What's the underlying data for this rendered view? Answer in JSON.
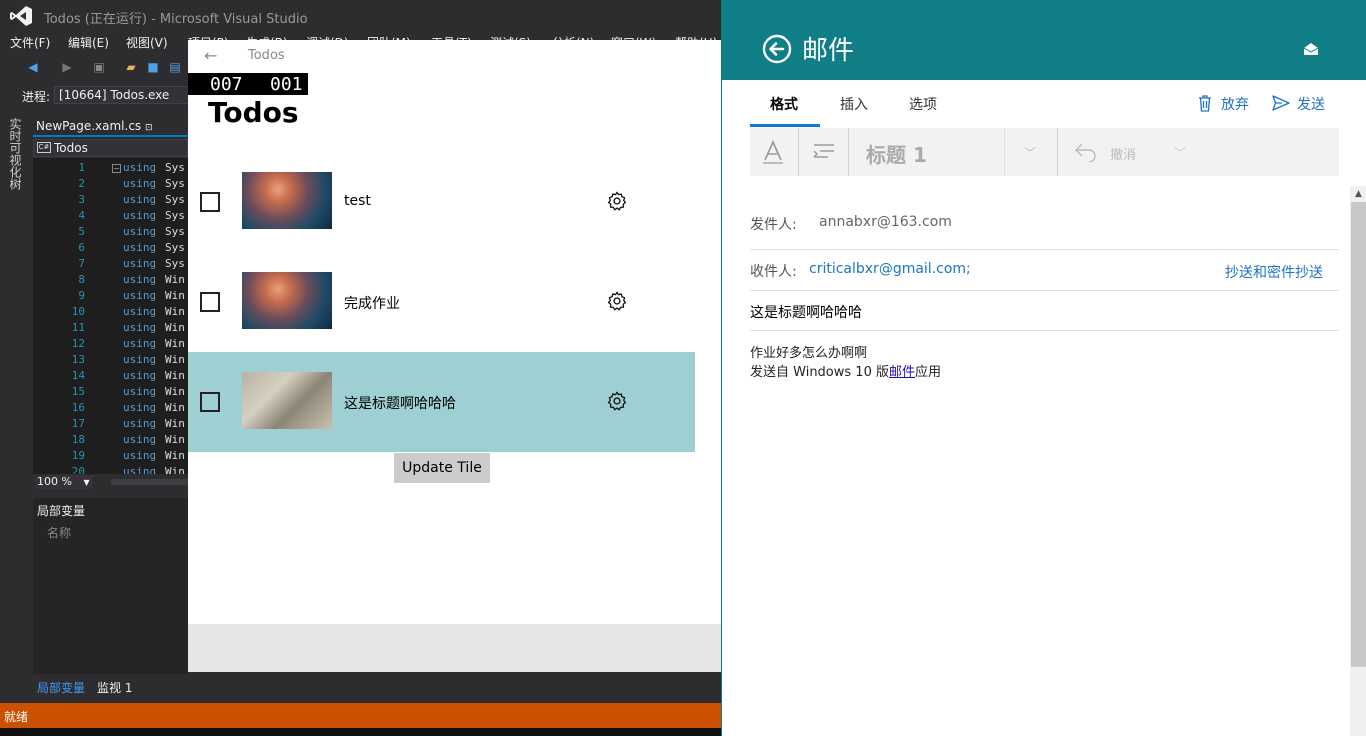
{
  "vs": {
    "title": "Todos (正在运行) - Microsoft Visual Studio",
    "menu": [
      "文件(F)",
      "编辑(E)",
      "视图(V)",
      "项目(P)",
      "生成(B)",
      "调试(D)",
      "团队(M)",
      "工具(T)",
      "测试(S)",
      "分析(N)",
      "窗口(W)",
      "帮助(H)"
    ],
    "process_label": "进程:",
    "process_value": "[10664] Todos.exe",
    "left_tool_label": "实时可视化树",
    "doc_tab": "NewPage.xaml.cs",
    "doc_tab_pin": "⊡",
    "nav_cs_badge": "C#",
    "nav_label": "Todos",
    "code_lines": [
      {
        "n": "1",
        "kw": "using",
        "ns": "Sys"
      },
      {
        "n": "2",
        "kw": "using",
        "ns": "Sys"
      },
      {
        "n": "3",
        "kw": "using",
        "ns": "Sys"
      },
      {
        "n": "4",
        "kw": "using",
        "ns": "Sys"
      },
      {
        "n": "5",
        "kw": "using",
        "ns": "Sys"
      },
      {
        "n": "6",
        "kw": "using",
        "ns": "Sys"
      },
      {
        "n": "7",
        "kw": "using",
        "ns": "Sys"
      },
      {
        "n": "8",
        "kw": "using",
        "ns": "Win"
      },
      {
        "n": "9",
        "kw": "using",
        "ns": "Win"
      },
      {
        "n": "10",
        "kw": "using",
        "ns": "Win"
      },
      {
        "n": "11",
        "kw": "using",
        "ns": "Win"
      },
      {
        "n": "12",
        "kw": "using",
        "ns": "Win"
      },
      {
        "n": "13",
        "kw": "using",
        "ns": "Win"
      },
      {
        "n": "14",
        "kw": "using",
        "ns": "Win"
      },
      {
        "n": "15",
        "kw": "using",
        "ns": "Win"
      },
      {
        "n": "16",
        "kw": "using",
        "ns": "Win"
      },
      {
        "n": "17",
        "kw": "using",
        "ns": "Win"
      },
      {
        "n": "18",
        "kw": "using",
        "ns": "Win"
      },
      {
        "n": "19",
        "kw": "using",
        "ns": "Win"
      },
      {
        "n": "20",
        "kw": "using",
        "ns": "Win"
      }
    ],
    "zoom": "100 %",
    "locals_title": "局部变量",
    "locals_col_name": "名称",
    "bottom_tabs": [
      "局部变量",
      "监视 1"
    ],
    "status": "就绪"
  },
  "todos": {
    "back_glyph": "←",
    "window_title": "Todos",
    "fps_left": "007",
    "fps_right": "001",
    "heading": "Todos",
    "items": [
      {
        "title": "test",
        "selected": false
      },
      {
        "title": "完成作业",
        "selected": false
      },
      {
        "title": "这是标题啊哈哈哈",
        "selected": true
      }
    ],
    "update_tile_label": "Update Tile"
  },
  "mail": {
    "title": "邮件",
    "tabs": [
      "格式",
      "插入",
      "选项"
    ],
    "discard": "放弃",
    "send": "发送",
    "style_value": "标题 1",
    "undo_label": "撤消",
    "from_label": "发件人:",
    "from_value": "annabxr@163.com",
    "to_label": "收件人:",
    "to_value": "criticalbxr@gmail.com;",
    "cc_bcc": "抄送和密件抄送",
    "subject": "这是标题啊哈哈哈",
    "body_line1": "作业好多怎么办啊啊",
    "body_line2_prefix": "发送自 Windows 10 版",
    "body_line2_link": "邮件",
    "body_line2_suffix": "应用",
    "colors": {
      "header": "#0f7e86",
      "accent": "#1e73c8",
      "vs_status": "#ca5100",
      "selected_row": "#9dcfd3"
    }
  }
}
